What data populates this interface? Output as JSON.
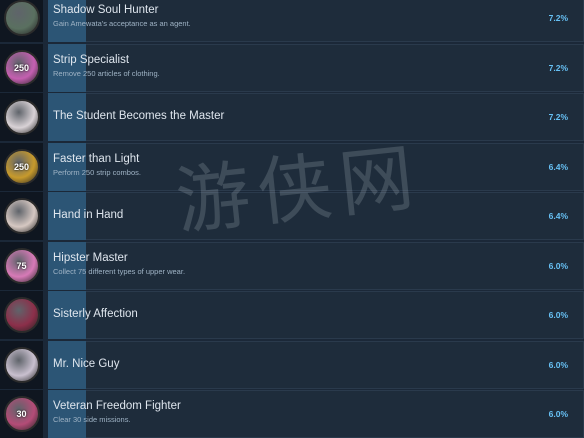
{
  "achievements": [
    {
      "title": "Shadow Soul Hunter",
      "desc": "Gain Amewata's acceptance as an agent.",
      "pct": "7.2%",
      "icon": "helmet-badge-icon",
      "icon_label": "",
      "icon_color": "#5a7060"
    },
    {
      "title": "Strip Specialist",
      "desc": "Remove 250 articles of clothing.",
      "pct": "7.2%",
      "icon": "pink-250-badge-icon",
      "icon_label": "250",
      "icon_color": "#c45fb0"
    },
    {
      "title": "The Student Becomes the Master",
      "desc": "",
      "pct": "7.2%",
      "icon": "dark-hair-girl-icon",
      "icon_label": "",
      "icon_color": "#d9d2d6"
    },
    {
      "title": "Faster than Light",
      "desc": "Perform 250 strip combos.",
      "pct": "6.4%",
      "icon": "gold-250-badge-icon",
      "icon_label": "250",
      "icon_color": "#c79a2c"
    },
    {
      "title": "Hand in Hand",
      "desc": "",
      "pct": "6.4%",
      "icon": "two-girls-icon",
      "icon_label": "",
      "icon_color": "#d6c8c2"
    },
    {
      "title": "Hipster Master",
      "desc": "Collect 75 different types of upper wear.",
      "pct": "6.0%",
      "icon": "shirt-75-badge-icon",
      "icon_label": "75",
      "icon_color": "#d77ab7"
    },
    {
      "title": "Sisterly Affection",
      "desc": "",
      "pct": "6.0%",
      "icon": "red-eyed-girl-icon",
      "icon_label": "",
      "icon_color": "#8c2f4a"
    },
    {
      "title": "Mr. Nice Guy",
      "desc": "",
      "pct": "6.0%",
      "icon": "pale-girl-icon",
      "icon_label": "",
      "icon_color": "#c9c0cf"
    },
    {
      "title": "Veteran Freedom Fighter",
      "desc": "Clear 30 side missions.",
      "pct": "6.0%",
      "icon": "sidemissions-30-badge-icon",
      "icon_label": "30",
      "icon_color": "#b44c77"
    }
  ],
  "watermark": "游侠网"
}
